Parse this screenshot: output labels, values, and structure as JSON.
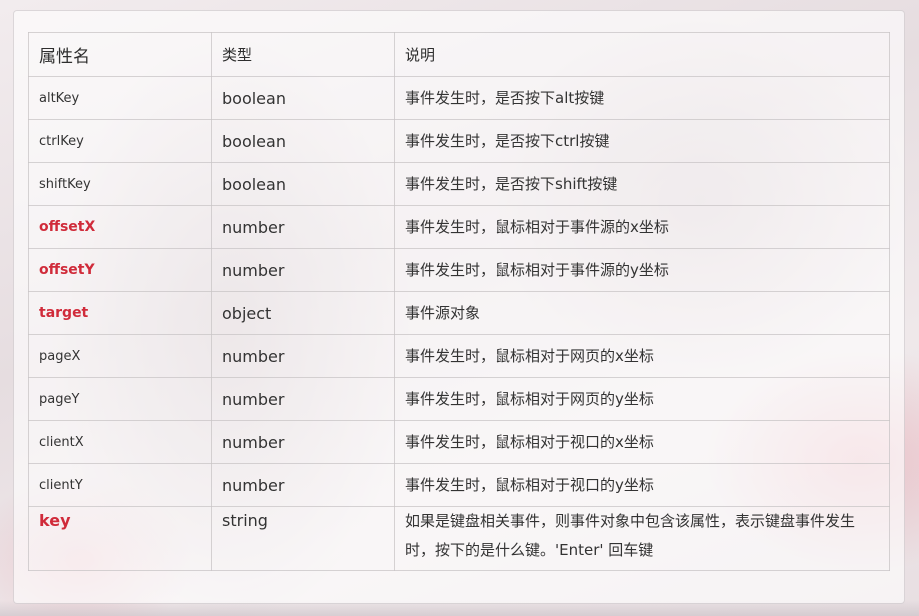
{
  "table": {
    "headers": [
      "属性名",
      "类型",
      "说明"
    ],
    "rows": [
      {
        "name": "altKey",
        "type": "boolean",
        "desc": "事件发生时，是否按下alt按键"
      },
      {
        "name": "ctrlKey",
        "type": "boolean",
        "desc": "事件发生时，是否按下ctrl按键"
      },
      {
        "name": "shiftKey",
        "type": "boolean",
        "desc": "事件发生时，是否按下shift按键"
      },
      {
        "name": "offsetX",
        "type": "number",
        "desc": "事件发生时，鼠标相对于事件源的x坐标"
      },
      {
        "name": "offsetY",
        "type": "number",
        "desc": "事件发生时，鼠标相对于事件源的y坐标"
      },
      {
        "name": "target",
        "type": "object",
        "desc": "事件源对象"
      },
      {
        "name": "pageX",
        "type": "number",
        "desc": "事件发生时，鼠标相对于网页的x坐标"
      },
      {
        "name": "pageY",
        "type": "number",
        "desc": "事件发生时，鼠标相对于网页的y坐标"
      },
      {
        "name": "clientX",
        "type": "number",
        "desc": "事件发生时，鼠标相对于视口的x坐标"
      },
      {
        "name": "clientY",
        "type": "number",
        "desc": "事件发生时，鼠标相对于视口的y坐标"
      },
      {
        "name": "key",
        "type": "string",
        "desc": "如果是键盘相关事件，则事件对象中包含该属性，表示键盘事件发生时，按下的是什么键。'Enter' 回车键"
      }
    ]
  },
  "colors": {
    "highlight": "#d02b3a",
    "text": "#333333"
  }
}
